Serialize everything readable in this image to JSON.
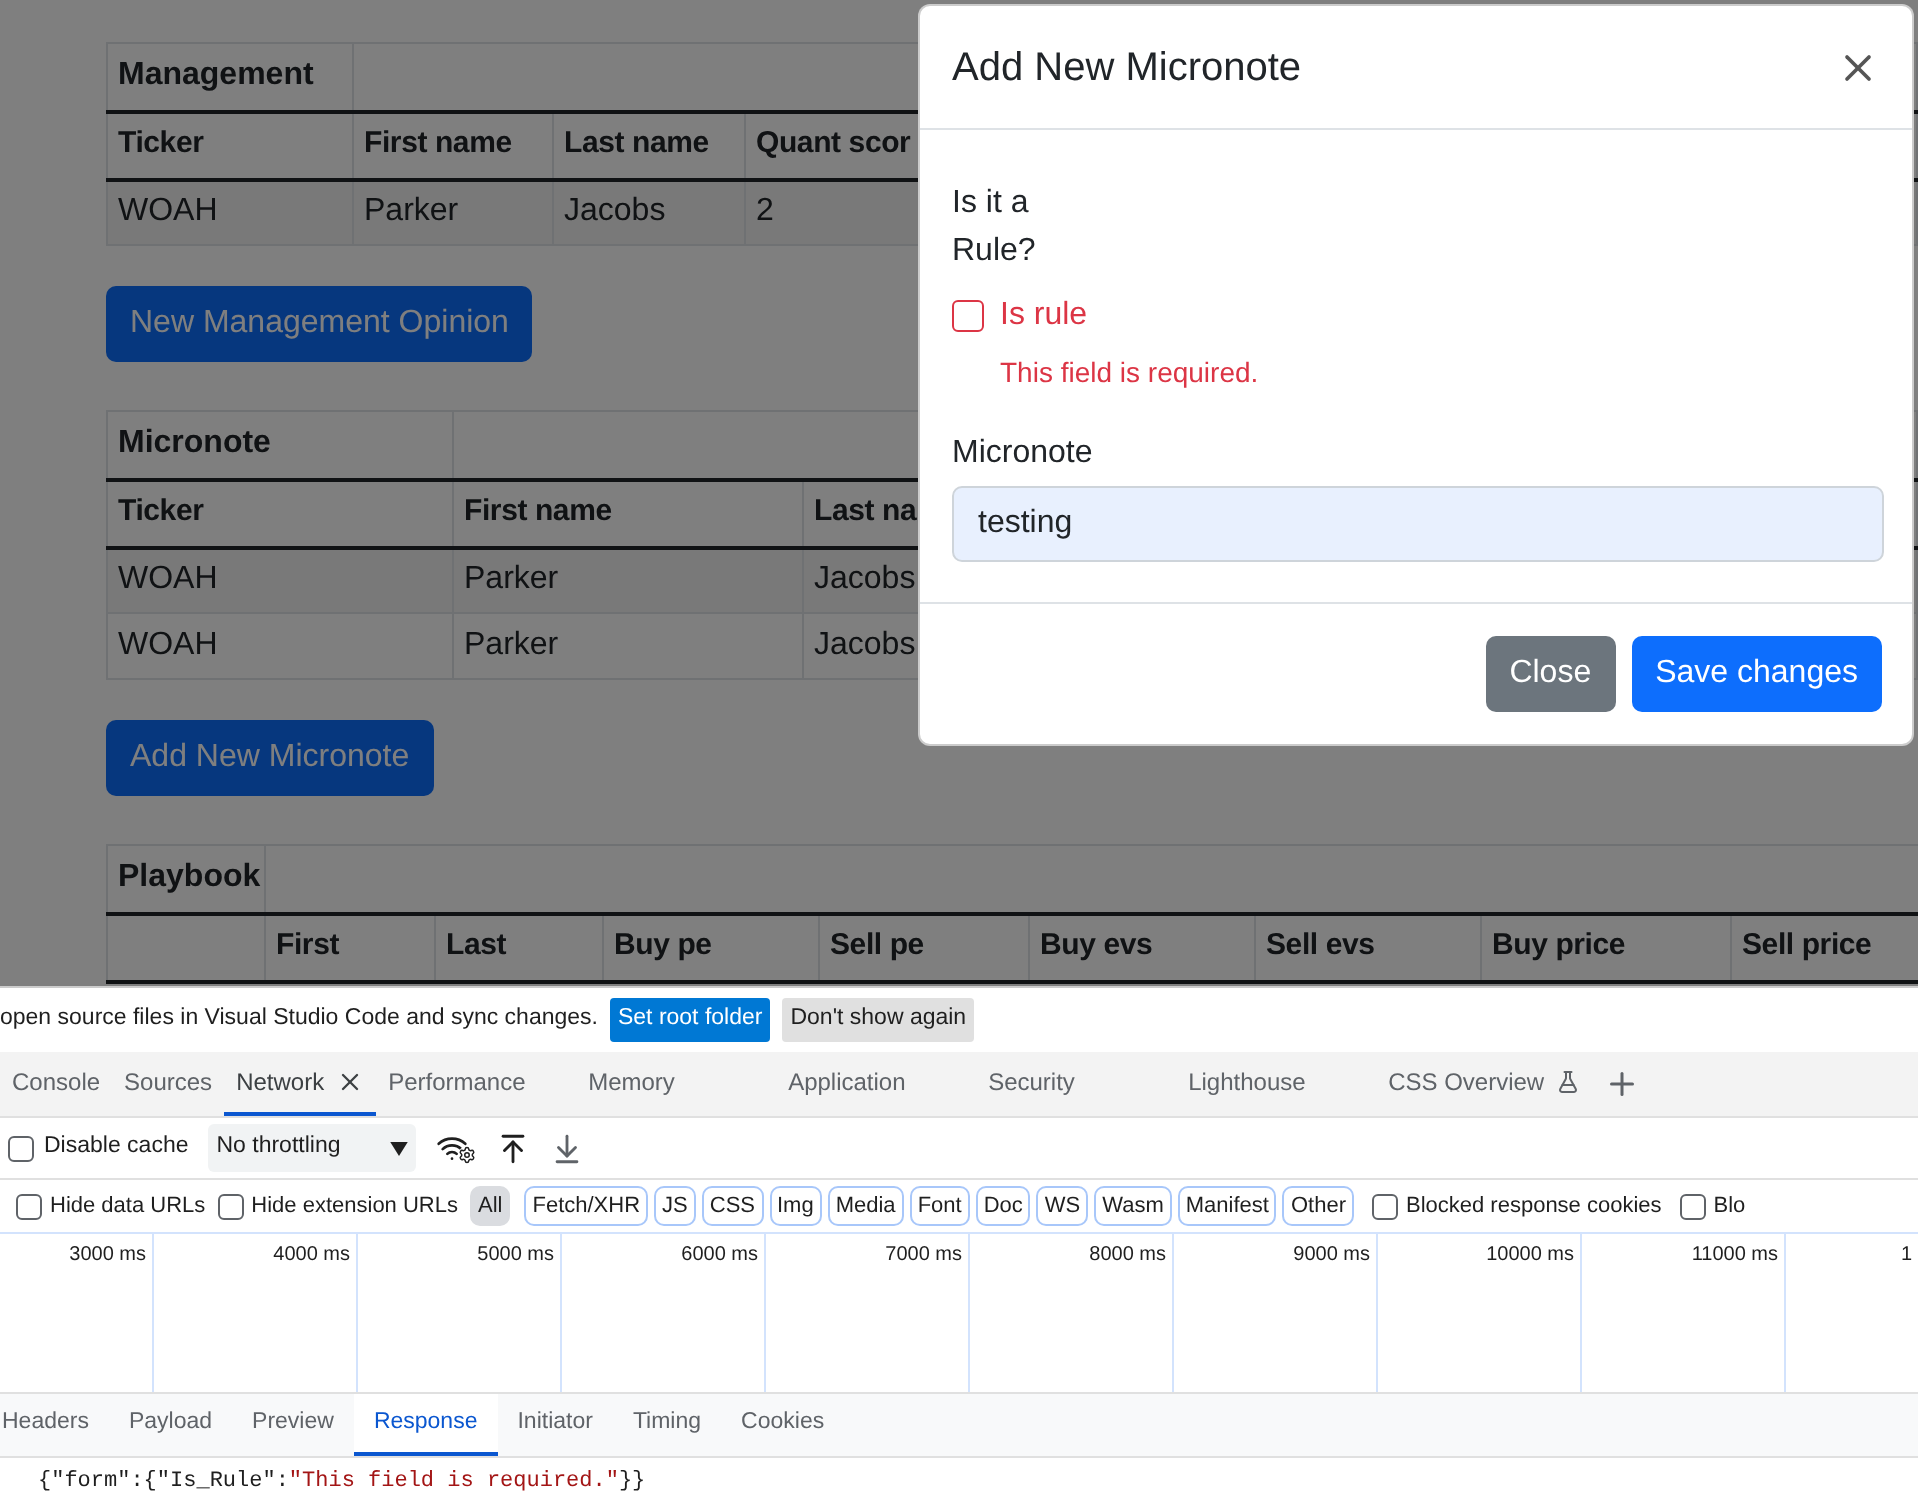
{
  "page": {
    "management_table": {
      "title": "Management",
      "columns": [
        "Ticker",
        "First name",
        "Last name",
        "Quant scor"
      ],
      "rows": [
        [
          "WOAH",
          "Parker",
          "Jacobs",
          "2"
        ]
      ]
    },
    "management_button": "New Management Opinion",
    "micronote_table": {
      "title": "Micronote",
      "columns": [
        "Ticker",
        "First name",
        "Last na"
      ],
      "rows": [
        [
          "WOAH",
          "Parker",
          "Jacobs"
        ],
        [
          "WOAH",
          "Parker",
          "Jacobs"
        ]
      ]
    },
    "micronote_button": "Add New Micronote",
    "playbook_table": {
      "title": "Playbook",
      "columns": [
        "First",
        "Last",
        "Buy pe",
        "Sell pe",
        "Buy evs",
        "Sell evs",
        "Buy price",
        "Sell price"
      ]
    }
  },
  "modal": {
    "title": "Add New Micronote",
    "rule_label": "Is it a Rule?",
    "checkbox": {
      "label": "Is rule",
      "checked": false,
      "invalid": true
    },
    "error": "This field is required.",
    "micronote_label": "Micronote",
    "micronote_value": "testing",
    "buttons": [
      {
        "label": "Close",
        "kind": "secondary"
      },
      {
        "label": "Save changes",
        "kind": "primary"
      }
    ]
  },
  "devtools": {
    "infobar": {
      "text": "open source files in Visual Studio Code and sync changes.",
      "buttons": [
        {
          "label": "Set root folder",
          "kind": "primary"
        },
        {
          "label": "Don't show again",
          "kind": "secondary"
        }
      ]
    },
    "tabs": [
      {
        "label": "Console",
        "selected": false
      },
      {
        "label": "Sources",
        "selected": false
      },
      {
        "label": "Network",
        "selected": true
      },
      {
        "label": "Performance",
        "selected": false
      },
      {
        "label": "Memory",
        "selected": false
      },
      {
        "label": "Application",
        "selected": false
      },
      {
        "label": "Security",
        "selected": false
      },
      {
        "label": "Lighthouse",
        "selected": false
      },
      {
        "label": "CSS Overview",
        "selected": false
      }
    ],
    "disable_cache": {
      "label": "Disable cache",
      "checked": false
    },
    "throttling": "No throttling",
    "filter_checks": [
      {
        "label": "Hide data URLs",
        "checked": false
      },
      {
        "label": "Hide extension URLs",
        "checked": false
      }
    ],
    "filters": [
      {
        "label": "All",
        "selected": true
      },
      {
        "label": "Fetch/XHR",
        "selected": false
      },
      {
        "label": "JS",
        "selected": false
      },
      {
        "label": "CSS",
        "selected": false
      },
      {
        "label": "Img",
        "selected": false
      },
      {
        "label": "Media",
        "selected": false
      },
      {
        "label": "Font",
        "selected": false
      },
      {
        "label": "Doc",
        "selected": false
      },
      {
        "label": "WS",
        "selected": false
      },
      {
        "label": "Wasm",
        "selected": false
      },
      {
        "label": "Manifest",
        "selected": false
      },
      {
        "label": "Other",
        "selected": false
      }
    ],
    "extra_checks": [
      {
        "label": "Blocked response cookies",
        "checked": false
      },
      {
        "label": "Blo",
        "checked": false
      }
    ],
    "timeline_ticks": [
      "3000 ms",
      "4000 ms",
      "5000 ms",
      "6000 ms",
      "7000 ms",
      "8000 ms",
      "9000 ms",
      "10000 ms",
      "11000 ms",
      "1"
    ],
    "detail_tabs": [
      {
        "label": "Headers",
        "selected": false
      },
      {
        "label": "Payload",
        "selected": false
      },
      {
        "label": "Preview",
        "selected": false
      },
      {
        "label": "Response",
        "selected": true
      },
      {
        "label": "Initiator",
        "selected": false
      },
      {
        "label": "Timing",
        "selected": false
      },
      {
        "label": "Cookies",
        "selected": false
      }
    ],
    "response": [
      {
        "kind": "plain",
        "text": "{\"form\":{\"Is_Rule\":"
      },
      {
        "kind": "string",
        "text": "\"This field is required.\""
      },
      {
        "kind": "plain",
        "text": "}}"
      }
    ]
  }
}
